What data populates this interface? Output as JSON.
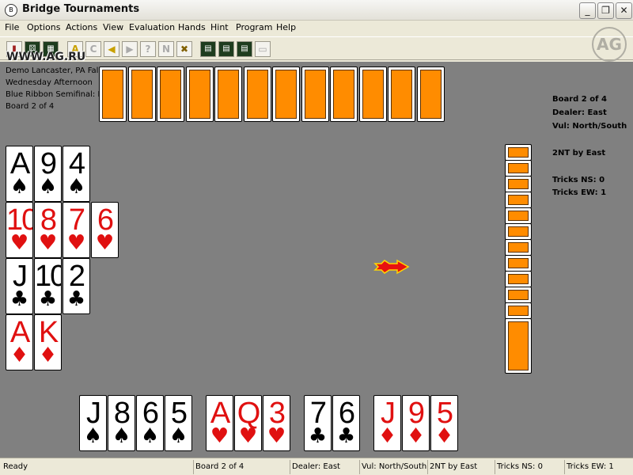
{
  "window": {
    "title": "Bridge Tournaments",
    "icon_text": "B",
    "min_glyph": "_",
    "max_glyph": "❐",
    "close_glyph": "✕"
  },
  "menu": [
    "File",
    "Options",
    "Actions",
    "View",
    "Evaluation",
    "Hands",
    "Hint",
    "Program",
    "Help"
  ],
  "toolbar": {
    "buttons": [
      {
        "icon": "stop-icon",
        "glyph": "▮"
      },
      {
        "icon": "dice-icon",
        "glyph": "⚄"
      },
      {
        "icon": "grid-icon",
        "glyph": "▦"
      },
      {
        "icon": "hint-a-icon",
        "glyph": "A"
      },
      {
        "icon": "clear-icon",
        "glyph": "C"
      },
      {
        "icon": "back-icon",
        "glyph": "◀"
      },
      {
        "icon": "forward-icon",
        "glyph": "▶"
      },
      {
        "icon": "question-icon",
        "glyph": "?"
      },
      {
        "icon": "next-icon",
        "glyph": "N"
      },
      {
        "icon": "cancel-icon",
        "glyph": "✖"
      },
      {
        "icon": "film-1-icon",
        "glyph": "▤"
      },
      {
        "icon": "film-2-icon",
        "glyph": "▤"
      },
      {
        "icon": "film-3-icon",
        "glyph": "▤"
      },
      {
        "icon": "film-4-icon",
        "glyph": "▭"
      }
    ]
  },
  "watermark": "WWW.AG.RU",
  "watermark_logo": "AG",
  "info_left": [
    "Demo Lancaster, PA Fal",
    "Wednesday Afternoon",
    "Blue Ribbon Semifinal: N",
    "Board 2 of 4"
  ],
  "info_right": {
    "board": "Board 2 of 4",
    "dealer": "Dealer: East",
    "vul": "Vul: North/South",
    "contract": "2NT by East",
    "tricks_ns": "Tricks NS: 0",
    "tricks_ew": "Tricks EW: 1"
  },
  "north_back_count": 12,
  "east_back_count": 12,
  "west_hand": [
    {
      "suit": "♠",
      "color": "black",
      "ranks": [
        "A",
        "9",
        "4"
      ]
    },
    {
      "suit": "♥",
      "color": "red",
      "ranks": [
        "10",
        "8",
        "7",
        "6"
      ]
    },
    {
      "suit": "♣",
      "color": "black",
      "ranks": [
        "J",
        "10",
        "2"
      ]
    },
    {
      "suit": "♦",
      "color": "red",
      "ranks": [
        "A",
        "K"
      ]
    }
  ],
  "south_hand": [
    {
      "suit": "♠",
      "color": "black",
      "ranks": [
        "J",
        "8",
        "6",
        "5"
      ]
    },
    {
      "suit": "♥",
      "color": "red",
      "ranks": [
        "A",
        "Q",
        "3"
      ]
    },
    {
      "suit": "♣",
      "color": "black",
      "ranks": [
        "7",
        "6"
      ]
    },
    {
      "suit": "♦",
      "color": "red",
      "ranks": [
        "J",
        "9",
        "5"
      ]
    }
  ],
  "status": {
    "ready": "Ready",
    "board": "Board 2 of 4",
    "dealer": "Dealer: East",
    "vul": "Vul: North/South",
    "contract": "2NT by East",
    "tricks_ns": "Tricks NS: 0",
    "tricks_ew": "Tricks EW: 1"
  },
  "colors": {
    "table": "#808080",
    "card_back": "#ff8c00",
    "red_suit": "#e01010"
  }
}
